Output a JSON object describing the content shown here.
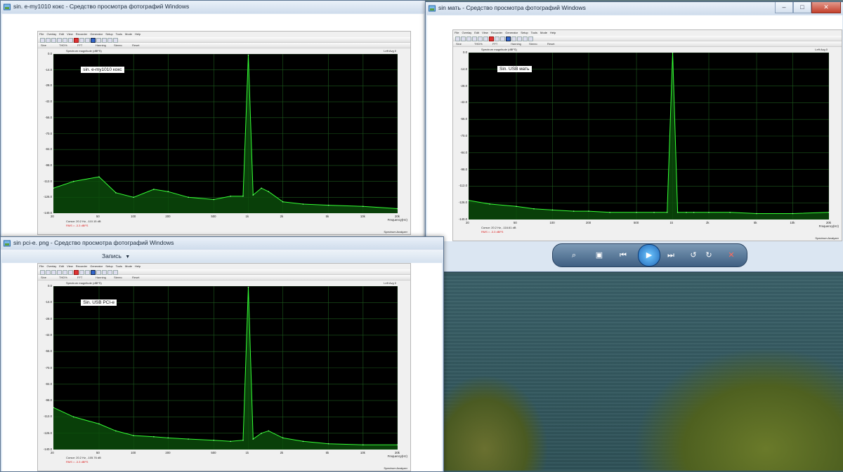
{
  "windows": [
    {
      "title": "sin. e-my1010 кокс - Средство просмотра фотографий Windows",
      "chart_note": "sin. e-my1010 кокс",
      "cursor_text": "Cursor: 20.2 Hz, -110.15 dB",
      "rms_text": "RMS = -3.3 dBFS",
      "tag": "L"
    },
    {
      "title": "sin мать - Средство просмотра фотографий Windows",
      "chart_note": "Sin. USB мать",
      "cursor_text": "Cursor: 20.2 Hz, -116.61 dB",
      "rms_text": "RMS = -3.3 dBFS",
      "tag": "R"
    },
    {
      "title": "sin pci-e. png - Средство просмотра фотографий Windows",
      "menu_label": "Запись",
      "chart_note": "Sin. USB PCI-e",
      "cursor_text": "Cursor: 20.2 Hz, -105.76 dB",
      "rms_text": "RMS = -3.3 dBFS",
      "tag": "P"
    }
  ],
  "analyzer": {
    "app_title": "Spectrum",
    "menu_items": [
      "File",
      "Overlay",
      "Edit",
      "View",
      "Recorder",
      "Generator",
      "Setup",
      "Tools",
      "Mode",
      "Help"
    ],
    "toolbar2": [
      "Sine",
      "THD%",
      "FFT",
      "Hanning",
      "Stereo",
      "Reset"
    ],
    "plot_title": "Spectrum magnitude (dBFS)",
    "plot_subtitle": "Left Avg 0",
    "y_ticks": [
      "0.0",
      "-14.0",
      "-28.0",
      "-42.0",
      "-56.0",
      "-70.0",
      "-84.0",
      "-98.0",
      "-112.0",
      "-126.0",
      "-140.0"
    ],
    "x_ticks": [
      "20",
      "50",
      "100",
      "200",
      "500",
      "1k",
      "2k",
      "5k",
      "10k",
      "20k"
    ],
    "x_axis_label": "Frequency(Hz)",
    "right_status": "Spectrum Analyzer"
  },
  "viewer_controls": {
    "buttons": [
      "zoom-icon",
      "fit-icon",
      "prev-icon",
      "slideshow-icon",
      "next-icon",
      "rotate-left-icon",
      "rotate-right-icon",
      "delete-icon"
    ],
    "glyphs": [
      "⌕",
      "▣",
      "⏮",
      "▶",
      "⏭",
      "↺",
      "↻",
      "✕"
    ]
  },
  "chart_data": [
    {
      "type": "line",
      "title": "Spectrum magnitude (dBFS)",
      "subtitle": "Left Avg 0",
      "xlabel": "Frequency(Hz)",
      "ylabel": "",
      "x_scale": "log",
      "xlim": [
        20,
        20000
      ],
      "ylim": [
        -140,
        0
      ],
      "annotation": "sin. e-my1010 кокс",
      "x": [
        20,
        30,
        50,
        70,
        100,
        150,
        200,
        300,
        500,
        700,
        900,
        1000,
        1100,
        1300,
        1500,
        2000,
        3000,
        5000,
        10000,
        20000
      ],
      "y": [
        -118,
        -112,
        -108,
        -122,
        -126,
        -119,
        -121,
        -126,
        -128,
        -125,
        -125,
        -1,
        -124,
        -118,
        -121,
        -130,
        -132,
        -133,
        -134,
        -136
      ]
    },
    {
      "type": "line",
      "title": "Spectrum magnitude (dBFS)",
      "subtitle": "Left Avg 0",
      "xlabel": "Frequency(Hz)",
      "ylabel": "",
      "x_scale": "log",
      "xlim": [
        20,
        20000
      ],
      "ylim": [
        -140,
        0
      ],
      "annotation": "Sin. USB мать",
      "x": [
        20,
        30,
        50,
        70,
        100,
        150,
        200,
        300,
        500,
        700,
        900,
        1000,
        1100,
        1300,
        1500,
        2000,
        3000,
        5000,
        10000,
        20000
      ],
      "y": [
        -124,
        -127,
        -129,
        -131,
        -132,
        -133,
        -133,
        -134,
        -134,
        -134,
        -134,
        0,
        -134,
        -134,
        -134,
        -134,
        -134,
        -135,
        -135,
        -134
      ]
    },
    {
      "type": "line",
      "title": "Spectrum magnitude (dBFS)",
      "subtitle": "Left Avg 0",
      "xlabel": "Frequency(Hz)",
      "ylabel": "",
      "x_scale": "log",
      "xlim": [
        20,
        20000
      ],
      "ylim": [
        -140,
        0
      ],
      "annotation": "Sin. USB PCI-e",
      "x": [
        20,
        30,
        50,
        70,
        100,
        150,
        200,
        300,
        500,
        700,
        900,
        1000,
        1100,
        1300,
        1500,
        2000,
        3000,
        5000,
        10000,
        20000
      ],
      "y": [
        -104,
        -112,
        -118,
        -124,
        -128,
        -129,
        -130,
        -131,
        -132,
        -133,
        -132,
        -1,
        -131,
        -126,
        -124,
        -130,
        -133,
        -135,
        -136,
        -136
      ]
    }
  ]
}
